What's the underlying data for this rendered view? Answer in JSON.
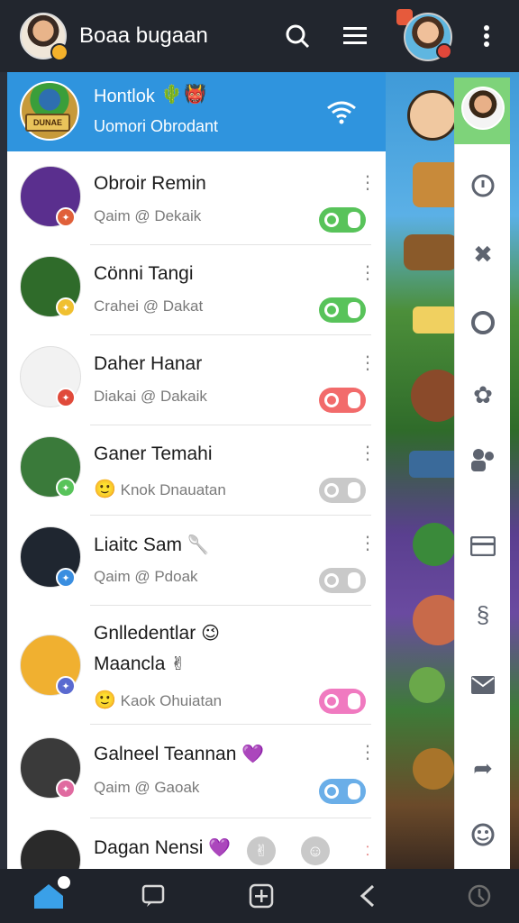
{
  "header": {
    "title": "Boaa bugaan",
    "avatar": "profile-avatar",
    "icons": [
      "search-icon",
      "menu-icon",
      "more-vert-icon"
    ]
  },
  "active_chat": {
    "name": "Hontlok",
    "subtitle": "Uomori Obrodant",
    "avatar_tag": "DUNAE",
    "emoji_1": "🌵",
    "emoji_2": "👹"
  },
  "chats": [
    {
      "name": "Obroir Remin",
      "subtitle": "Qaim @ Dekaik",
      "toggle_color": "#58c35a",
      "avatar_bg": "#5a2f8e",
      "badge_color": "#e0603a"
    },
    {
      "name": "Cönni Tangi",
      "subtitle": "Crahei @ Dakat",
      "toggle_color": "#58c35a",
      "avatar_bg": "#2f6b2a",
      "badge_color": "#f0c030"
    },
    {
      "name": "Daher Hanar",
      "subtitle": "Diakai @ Dakaik",
      "toggle_color": "#f26b6b",
      "avatar_bg": "#f2f2f2",
      "badge_color": "#e04a3a"
    },
    {
      "name": "Ganer Temahi",
      "subtitle": "Knok Dnauatan",
      "toggle_color": "#c9c9c9",
      "avatar_bg": "#3a7a3a",
      "badge_color": "#58c35a",
      "leading_emoji": "🙂"
    },
    {
      "name": "Liaitc Sam",
      "subtitle": "Qaim @ Pdoak",
      "toggle_color": "#c9c9c9",
      "avatar_bg": "#1f2630",
      "badge_color": "#3a8ee0",
      "trailing_emoji": "🥄"
    },
    {
      "name": "Gnlledentlar",
      "name_line2": "Maancla",
      "subtitle": "Kaok Ohuiatan",
      "toggle_color": "#f07ac0",
      "avatar_bg": "#f0b030",
      "badge_color": "#5a6ad0",
      "leading_emoji": "🙂",
      "trailing_emoji": "😉",
      "line2_emoji": "✌"
    },
    {
      "name": "Galneel Teannan",
      "subtitle": "Qaim @ Gaoak",
      "toggle_color": "#6aaee8",
      "avatar_bg": "#3a3a3a",
      "badge_color": "#e06aa0",
      "trailing_emoji": "💜"
    },
    {
      "name": "Dagan Nensi",
      "trailing_emoji": "💜",
      "avatar_bg": "#2a2a2a"
    }
  ],
  "rail_icons": [
    "clock-icon",
    "pin-icon",
    "circle-icon",
    "flower-icon",
    "people-icon",
    "card-icon",
    "link-icon",
    "mail-icon",
    "forward-icon",
    "smiley-icon"
  ],
  "bottom_nav": [
    "home-icon",
    "chat-icon",
    "add-icon",
    "back-icon",
    "settings-icon"
  ],
  "colors": {
    "header_bg": "#22262e",
    "active_row": "#2f94de",
    "rail_top": "#7ed37a"
  }
}
